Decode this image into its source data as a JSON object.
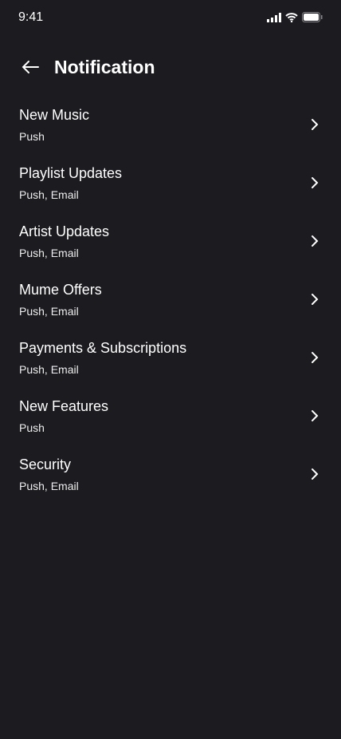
{
  "status": {
    "time": "9:41"
  },
  "header": {
    "title": "Notification"
  },
  "items": [
    {
      "title": "New Music",
      "subtitle": "Push"
    },
    {
      "title": "Playlist Updates",
      "subtitle": "Push, Email"
    },
    {
      "title": "Artist Updates",
      "subtitle": "Push, Email"
    },
    {
      "title": "Mume Offers",
      "subtitle": "Push, Email"
    },
    {
      "title": "Payments & Subscriptions",
      "subtitle": "Push, Email"
    },
    {
      "title": "New Features",
      "subtitle": "Push"
    },
    {
      "title": "Security",
      "subtitle": "Push, Email"
    }
  ]
}
